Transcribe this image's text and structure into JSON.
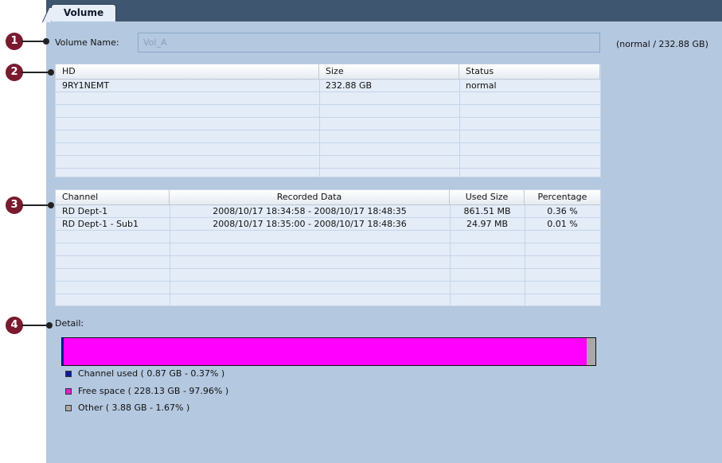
{
  "tab": {
    "label": "Volume"
  },
  "callouts": [
    "1",
    "2",
    "3",
    "4"
  ],
  "volume": {
    "label": "Volume Name:",
    "value": "Vol_A",
    "info": "(normal / 232.88 GB)"
  },
  "hd_table": {
    "columns": [
      "HD",
      "Size",
      "Status"
    ],
    "rows": [
      {
        "hd": "9RY1NEMT",
        "size": "232.88 GB",
        "status": "normal"
      }
    ]
  },
  "channel_table": {
    "columns": [
      "Channel",
      "Recorded Data",
      "Used Size",
      "Percentage"
    ],
    "rows": [
      {
        "channel": "RD Dept-1",
        "recorded": "2008/10/17 18:34:58 - 2008/10/17 18:48:35",
        "used": "861.51 MB",
        "pct": "0.36 %"
      },
      {
        "channel": "RD Dept-1 - Sub1",
        "recorded": "2008/10/17 18:35:00 - 2008/10/17 18:48:36",
        "used": "24.97 MB",
        "pct": "0.01 %"
      }
    ]
  },
  "detail": {
    "label": "Detail:",
    "usage": {
      "channel_used": 0.37,
      "free_space": 97.96,
      "other": 1.67
    },
    "legend": [
      {
        "text": "Channel used ( 0.87 GB - 0.37% )",
        "color": "#0a1aa0"
      },
      {
        "text": "Free space ( 228.13 GB - 97.96% )",
        "color": "#e020d0"
      },
      {
        "text": "Other ( 3.88 GB - 1.67% )",
        "color": "#a8a8a8"
      }
    ]
  }
}
